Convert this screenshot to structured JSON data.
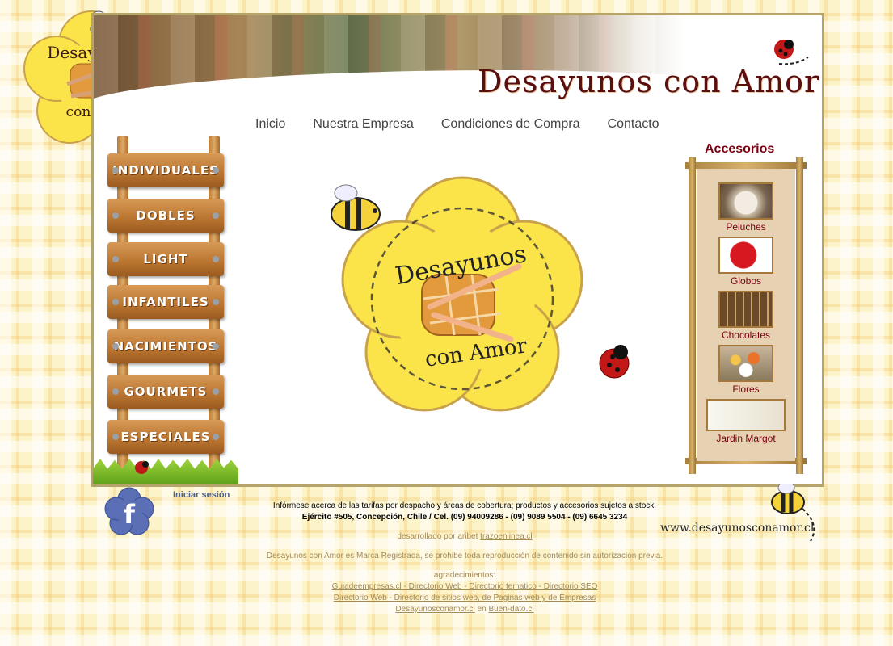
{
  "header": {
    "brand": "Desayunos con Amor",
    "logo_text_top": "Desayunos",
    "logo_text_bottom": "con Amor"
  },
  "nav": {
    "items": [
      "Inicio",
      "Nuestra Empresa",
      "Condiciones de Compra",
      "Contacto"
    ]
  },
  "categories": [
    "INDIVIDUALES",
    "DOBLES",
    "LIGHT",
    "INFANTILES",
    "NACIMIENTOS",
    "GOURMETS",
    "ESPECIALES"
  ],
  "accessories": {
    "title": "Accesorios",
    "items": [
      {
        "label": "Peluches",
        "icon": "plush-dog-icon"
      },
      {
        "label": "Globos",
        "icon": "heart-balloon-icon"
      },
      {
        "label": "Chocolates",
        "icon": "chocolate-box-icon"
      },
      {
        "label": "Flores",
        "icon": "flowers-icon"
      },
      {
        "label": "Jardin Margot",
        "icon": "jardin-margot-logo"
      }
    ]
  },
  "footer": {
    "login": "Iniciar sesión",
    "info_line": "Infórmese acerca de las tarifas por despacho y áreas de cobertura; productos y accesorios sujetos a stock.",
    "address_line": "Ejército #505, Concepción, Chile / Cel. (09) 94009286 - (09) 9089 5504 - (09) 6645 3234",
    "dev_prefix": "desarrollado por aribet",
    "dev_link": "trazoenlinea.cl",
    "copyright": "Desayunos con Amor es Marca Registrada, se prohibe toda reproducción de contenido sin autorización previa.",
    "thanks": "agradecimientos:",
    "links_1": "Guiadeempresas.cl - Directorio Web - Directorio tematico - Directorio SEO",
    "links_2": "Directorio Web - Directorio de sitios web, de Paginas web y de Empresas",
    "links_3_a": "Desayunosconamor.cl",
    "links_3_mid": "en",
    "links_3_b": "Buen-dato.cl",
    "website": "www.desayunosconamor.cl"
  },
  "colors": {
    "accent": "#7a0010",
    "wood": "#b9742f",
    "flower": "#fbe34a"
  }
}
